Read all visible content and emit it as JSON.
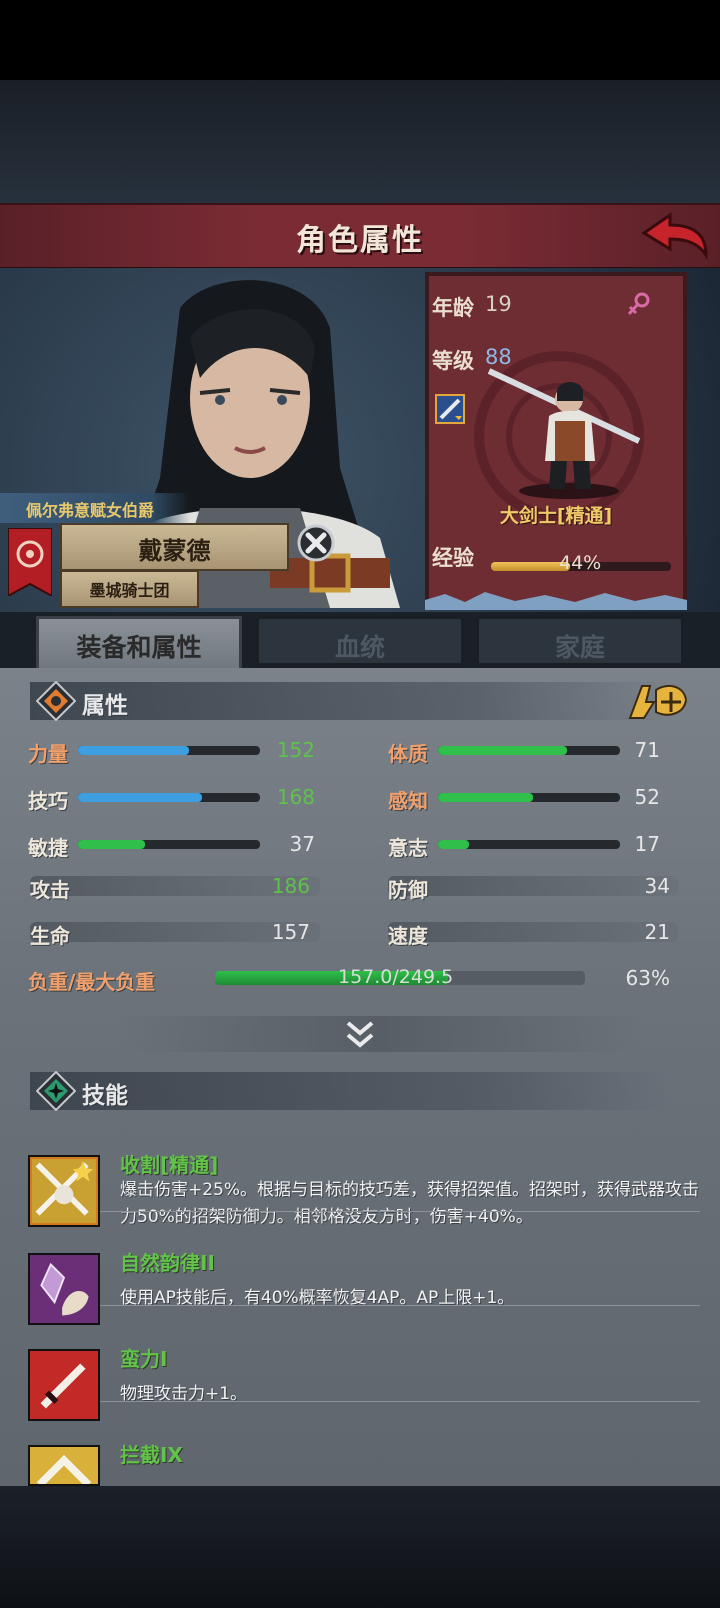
{
  "header": {
    "title": "角色属性"
  },
  "character": {
    "title": "佩尔弗意赋女伯爵",
    "name": "戴蒙德",
    "guild": "墨城骑士团",
    "age_label": "年龄",
    "age": "19",
    "level_label": "等级",
    "level": "88",
    "class": "大剑士[精通]",
    "exp_label": "经验",
    "exp_percent": "44%",
    "exp_fraction": 0.44
  },
  "tabs": [
    {
      "label": "装备和属性"
    },
    {
      "label": "血统"
    },
    {
      "label": "家庭"
    }
  ],
  "attributes": {
    "section_title": "属性",
    "stats": [
      {
        "label": "力量",
        "value": "152",
        "fill": 0.61,
        "color": "#3d9fe0"
      },
      {
        "label": "体质",
        "value": "71",
        "fill": 0.71,
        "color": "#2fbf4a"
      },
      {
        "label": "技巧",
        "value": "168",
        "fill": 0.68,
        "color": "#3d9fe0"
      },
      {
        "label": "感知",
        "value": "52",
        "fill": 0.52,
        "color": "#2fbf4a"
      },
      {
        "label": "敏捷",
        "value": "37",
        "fill": 0.37,
        "color": "#2fbf4a"
      },
      {
        "label": "意志",
        "value": "17",
        "fill": 0.17,
        "color": "#2fbf4a"
      }
    ],
    "combat": [
      {
        "label": "攻击",
        "value": "186"
      },
      {
        "label": "防御",
        "value": "34"
      },
      {
        "label": "生命",
        "value": "157"
      },
      {
        "label": "速度",
        "value": "21"
      }
    ],
    "load": {
      "label": "负重/最大负重",
      "value": "157.0/249.5",
      "percent": "63%",
      "fraction": 0.63
    }
  },
  "skills": {
    "section_title": "技能",
    "items": [
      {
        "name": "收割[精通]",
        "desc": "爆击伤害+25%。根据与目标的技巧差，获得招架值。招架时，获得武器攻击力50%的招架防御力。相邻格没友方时，伤害+40%。"
      },
      {
        "name": "自然韵律II",
        "desc": "使用AP技能后，有40%概率恢复4AP。AP上限+1。"
      },
      {
        "name": "蛮力I",
        "desc": "物理攻击力+1。"
      },
      {
        "name": "拦截IX",
        "desc": ""
      }
    ]
  },
  "colors": {
    "title_bar": "#7a2b34",
    "skill_name": "#62c24a",
    "value_green": "#5fc24a"
  }
}
